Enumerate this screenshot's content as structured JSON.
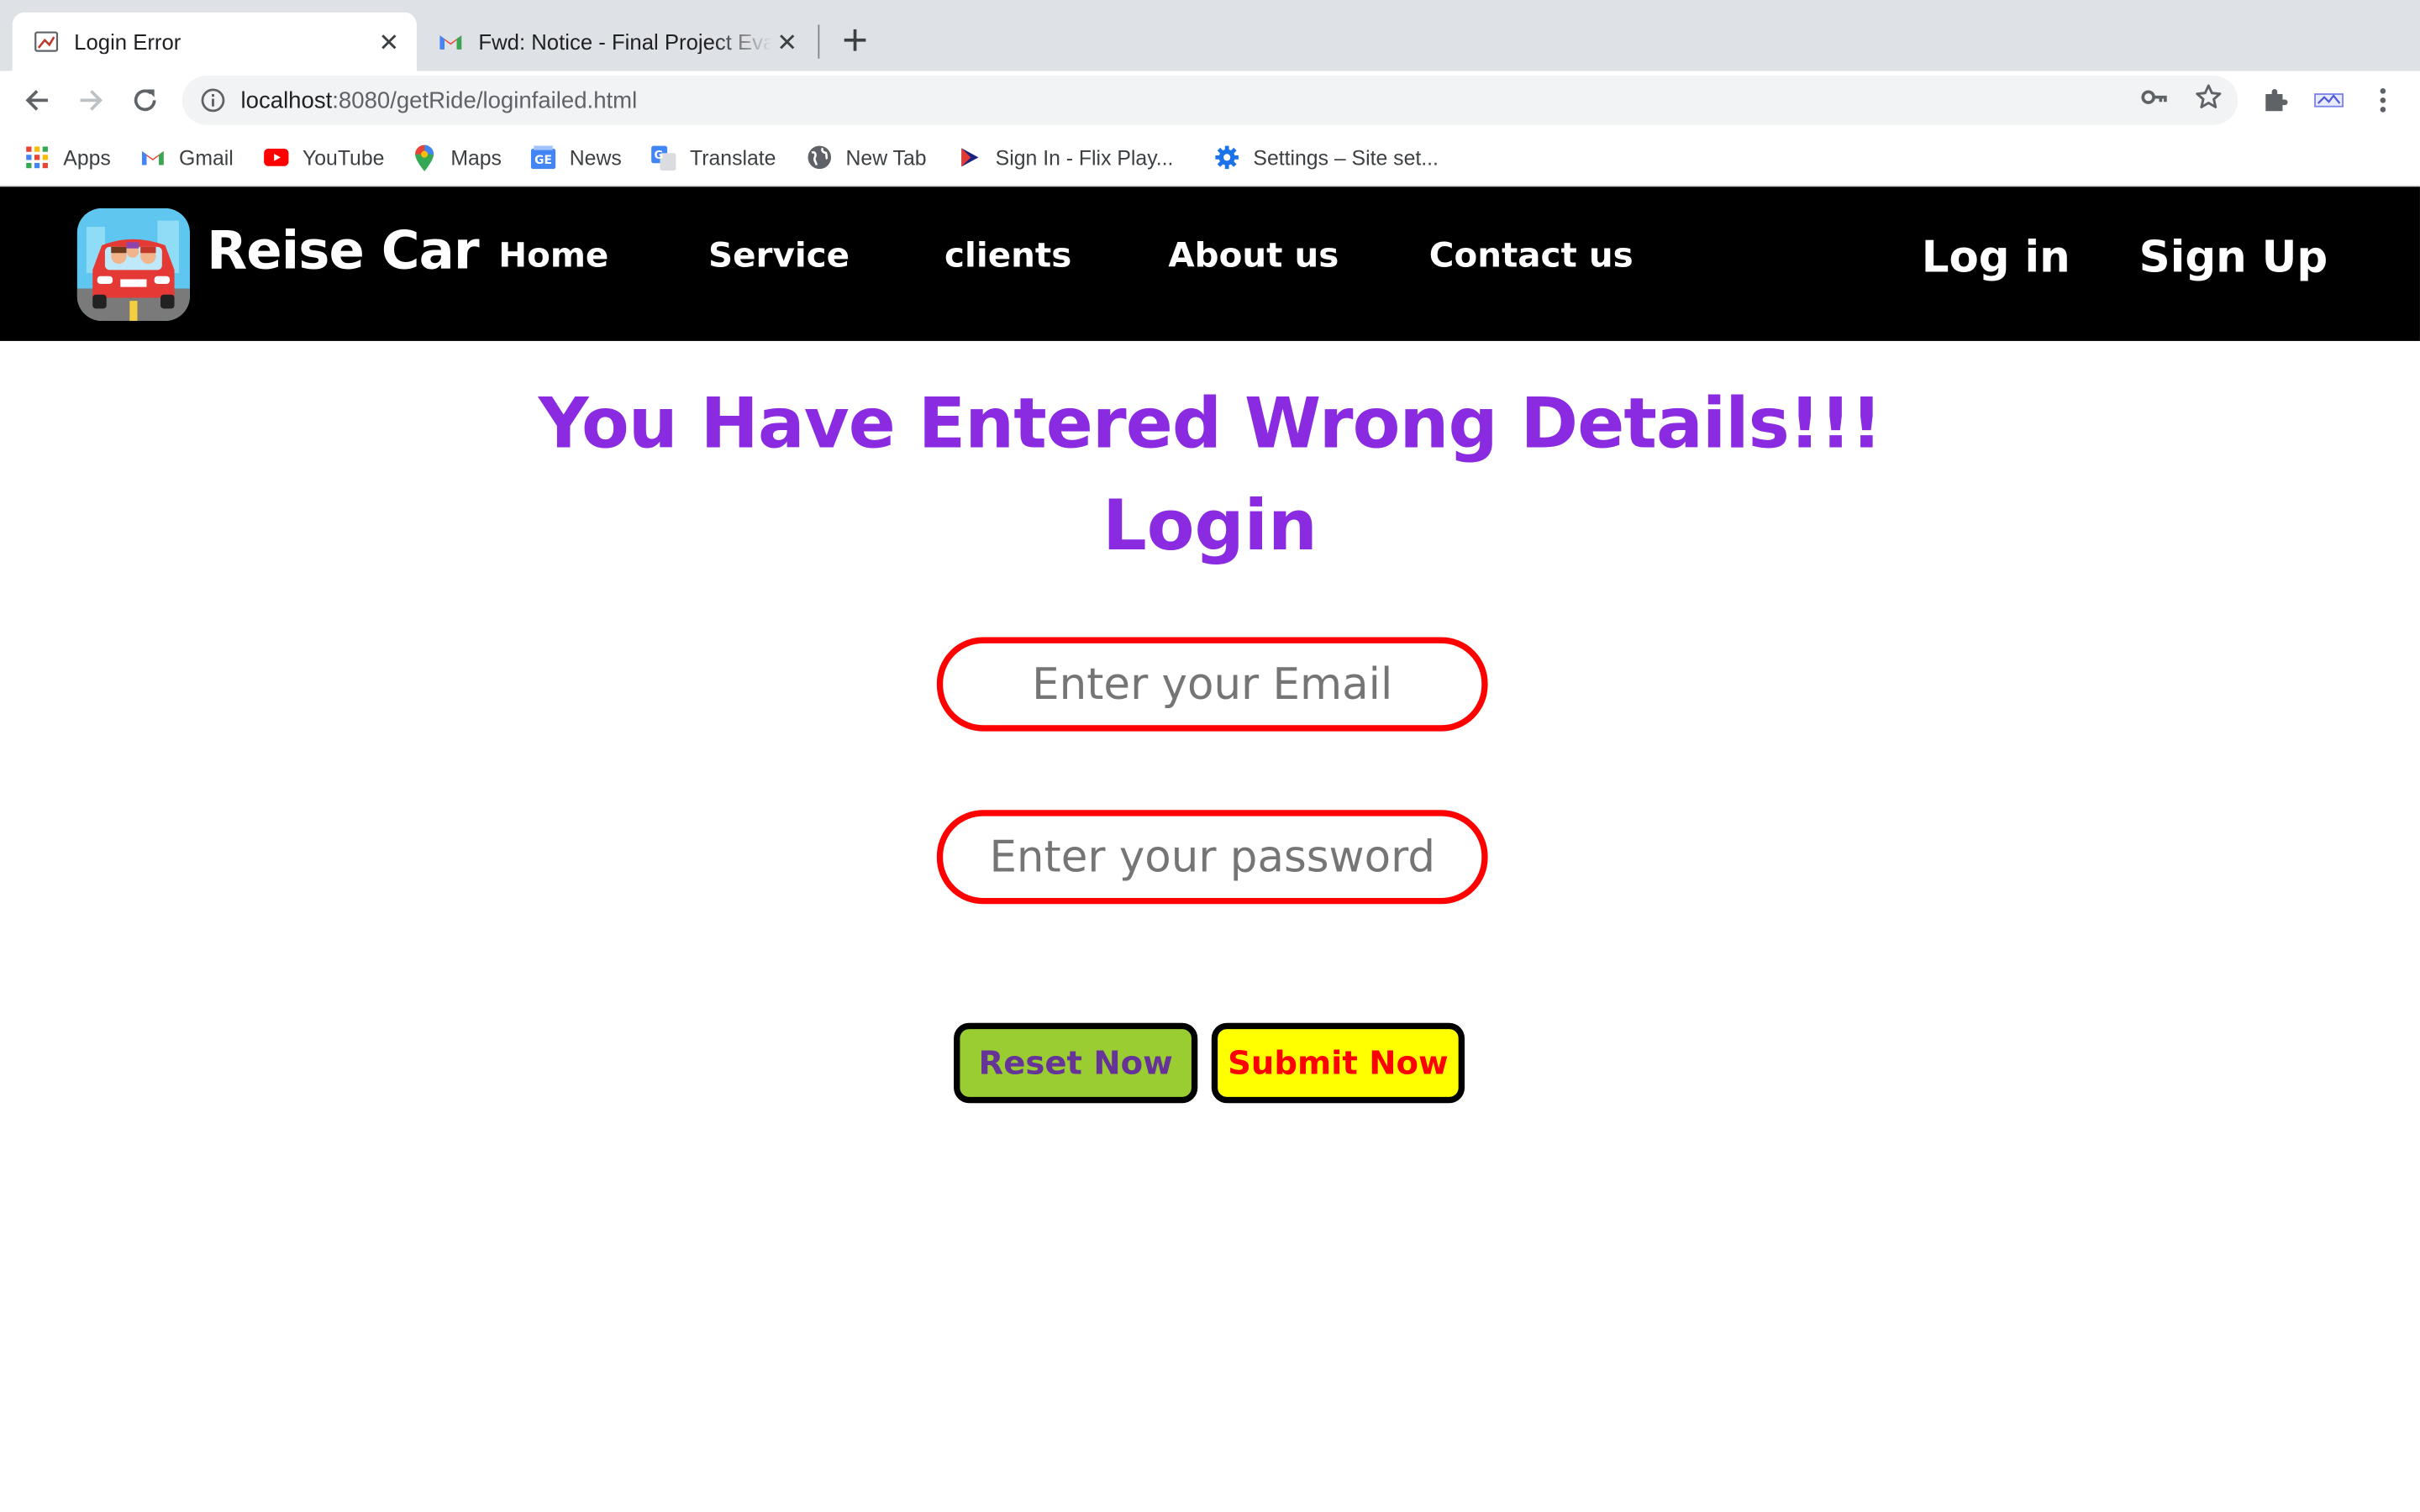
{
  "browser": {
    "tabs": [
      {
        "title": "Login Error",
        "favicon": "page-icon",
        "active": true
      },
      {
        "title": "Fwd: Notice - Final Project Evaluation",
        "favicon": "gmail-icon",
        "active": false
      }
    ],
    "url_host": "localhost",
    "url_path": ":8080/getRide/loginfailed.html",
    "bookmarks": [
      {
        "label": "Apps",
        "icon": "apps-grid-icon"
      },
      {
        "label": "Gmail",
        "icon": "gmail-icon"
      },
      {
        "label": "YouTube",
        "icon": "youtube-icon"
      },
      {
        "label": "Maps",
        "icon": "maps-pin-icon"
      },
      {
        "label": "News",
        "icon": "news-icon"
      },
      {
        "label": "Translate",
        "icon": "translate-icon"
      },
      {
        "label": "New Tab",
        "icon": "globe-icon"
      },
      {
        "label": "Sign In - Flix Play...",
        "icon": "play-icon"
      },
      {
        "label": "Settings – Site set...",
        "icon": "gear-icon"
      }
    ]
  },
  "site": {
    "brand": "Reise Car",
    "nav": [
      "Home",
      "Service",
      "clients",
      "About us",
      "Contact us"
    ],
    "login_link": "Log in",
    "signup_link": "Sign Up"
  },
  "content": {
    "error_heading": "You Have Entered Wrong Details!!!",
    "form_title": "Login",
    "email_placeholder": "Enter your Email",
    "password_placeholder": "Enter your password",
    "reset_label": "Reset Now",
    "submit_label": "Submit Now"
  },
  "colors": {
    "heading": "#8a2be2",
    "field_border": "#ff0000",
    "reset_bg": "#9acd32",
    "reset_text": "#663399",
    "submit_bg": "#ffff00",
    "submit_text": "#ff0000",
    "nav_bg": "#000000"
  }
}
